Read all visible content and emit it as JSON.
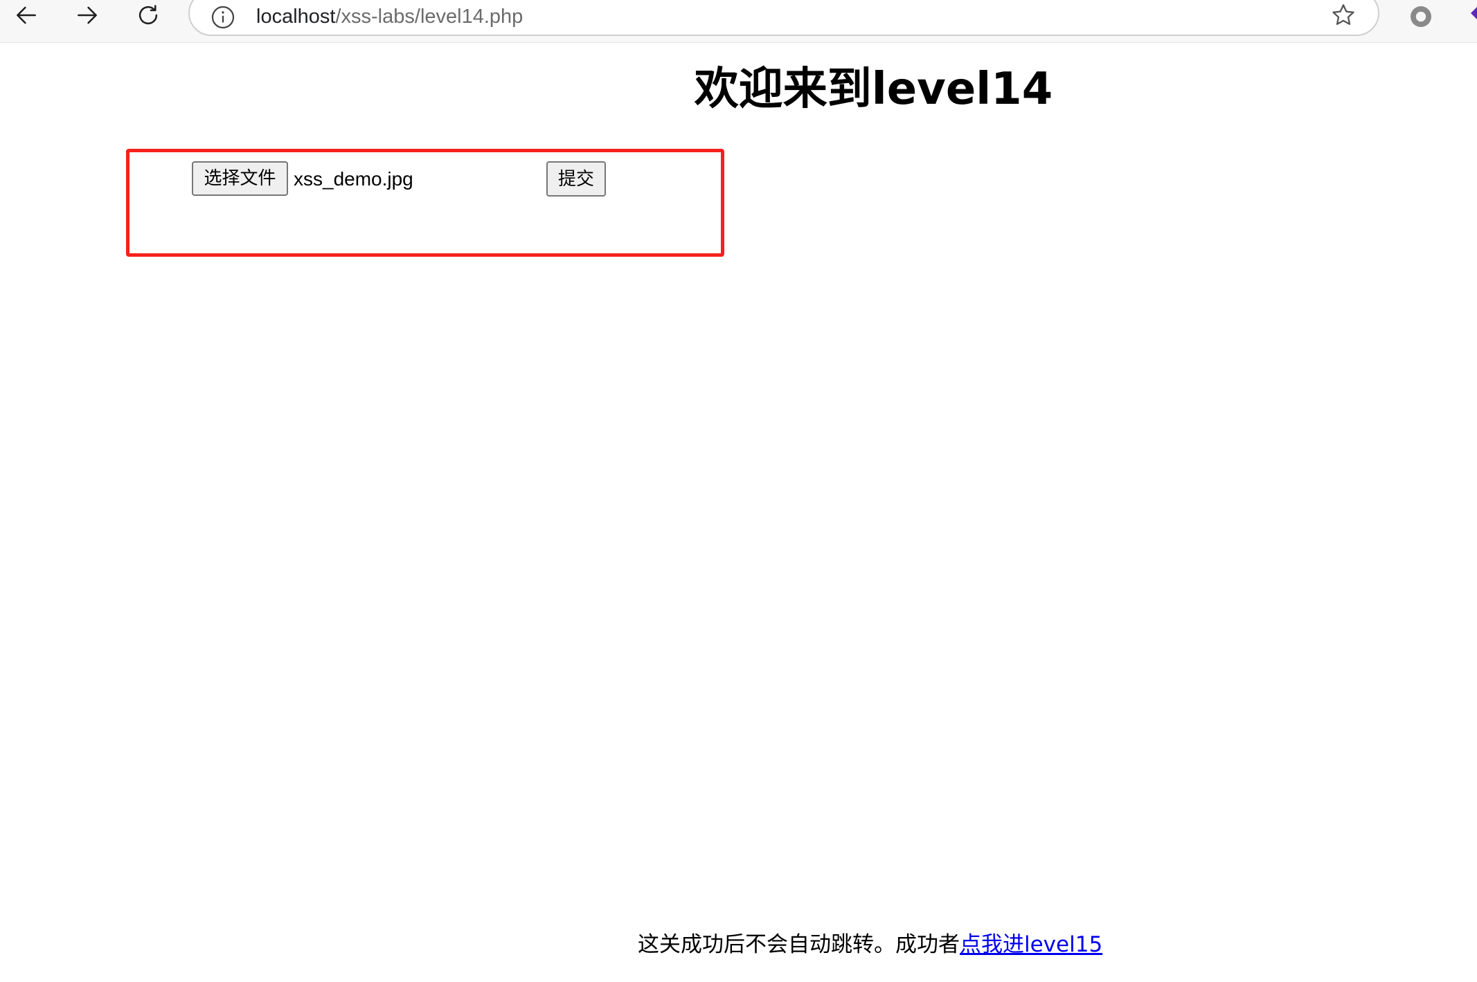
{
  "browser": {
    "url_host": "localhost",
    "url_path": "/xss-labs/level14.php",
    "icons": {
      "back": "arrow-left-icon",
      "forward": "arrow-right-icon",
      "reload": "reload-icon",
      "site_info": "info-icon",
      "bookmark": "star-icon",
      "extension": "circle-record-icon"
    }
  },
  "page": {
    "title": "欢迎来到level14",
    "upload": {
      "choose_button_label": "选择文件",
      "file_name": "xss_demo.jpg",
      "submit_button_label": "提交"
    },
    "footer": {
      "text": "这关成功后不会自动跳转。成功者",
      "link_text": "点我进level15"
    }
  },
  "colors": {
    "highlight_border": "#f5221b",
    "link": "#0000ee",
    "toolbar_bg": "#f7f7f7"
  }
}
